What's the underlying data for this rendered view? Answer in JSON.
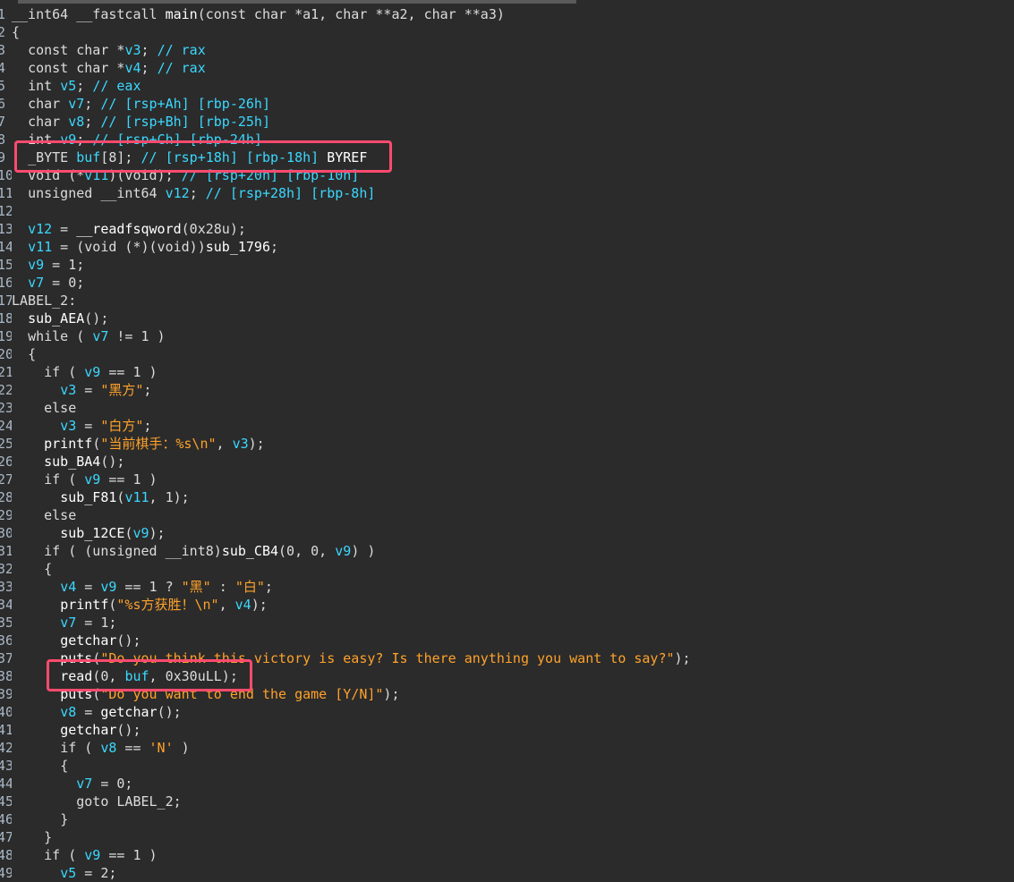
{
  "lines": [
    {
      "n": "1",
      "t": [
        [
          "ty",
          "__int64 __fastcall "
        ],
        [
          "fn",
          "main"
        ],
        [
          "ty",
          "(const char *a1, char **a2, char **a3)"
        ]
      ]
    },
    {
      "n": "2",
      "t": [
        [
          "kw",
          "{"
        ]
      ]
    },
    {
      "n": "3",
      "t": [
        [
          "ind",
          "  "
        ],
        [
          "ty",
          "const char *"
        ],
        [
          "var",
          "v3"
        ],
        [
          "kw",
          "; "
        ],
        [
          "cmt",
          "// rax"
        ]
      ]
    },
    {
      "n": "4",
      "t": [
        [
          "ind",
          "  "
        ],
        [
          "ty",
          "const char *"
        ],
        [
          "var",
          "v4"
        ],
        [
          "kw",
          "; "
        ],
        [
          "cmt",
          "// rax"
        ]
      ]
    },
    {
      "n": "5",
      "t": [
        [
          "ind",
          "  "
        ],
        [
          "ty",
          "int "
        ],
        [
          "var",
          "v5"
        ],
        [
          "kw",
          "; "
        ],
        [
          "cmt",
          "// eax"
        ]
      ]
    },
    {
      "n": "6",
      "t": [
        [
          "ind",
          "  "
        ],
        [
          "ty",
          "char "
        ],
        [
          "var",
          "v7"
        ],
        [
          "kw",
          "; "
        ],
        [
          "cmt",
          "// [rsp+Ah] [rbp-26h]"
        ]
      ]
    },
    {
      "n": "7",
      "t": [
        [
          "ind",
          "  "
        ],
        [
          "ty",
          "char "
        ],
        [
          "var",
          "v8"
        ],
        [
          "kw",
          "; "
        ],
        [
          "cmt",
          "// [rsp+Bh] [rbp-25h]"
        ]
      ]
    },
    {
      "n": "8",
      "t": [
        [
          "ind",
          "  "
        ],
        [
          "ty",
          "int "
        ],
        [
          "var",
          "v9"
        ],
        [
          "kw",
          "; "
        ],
        [
          "cmt",
          "// [rsp+Ch] [rbp-24h]"
        ]
      ]
    },
    {
      "n": "9",
      "t": [
        [
          "ind",
          "  "
        ],
        [
          "ty",
          "_BYTE "
        ],
        [
          "var",
          "buf"
        ],
        [
          "kw",
          "[8]; "
        ],
        [
          "cmt",
          "// [rsp+18h] [rbp-18h] "
        ],
        [
          "byref",
          "BYREF"
        ]
      ]
    },
    {
      "n": "10",
      "t": [
        [
          "ind",
          "  "
        ],
        [
          "ty",
          "void (*"
        ],
        [
          "var",
          "v11"
        ],
        [
          "ty",
          ")(void); "
        ],
        [
          "cmt",
          "// [rsp+20h] [rbp-10h]"
        ]
      ]
    },
    {
      "n": "11",
      "t": [
        [
          "ind",
          "  "
        ],
        [
          "ty",
          "unsigned __int64 "
        ],
        [
          "var",
          "v12"
        ],
        [
          "kw",
          "; "
        ],
        [
          "cmt",
          "// [rsp+28h] [rbp-8h]"
        ]
      ]
    },
    {
      "n": "12",
      "t": []
    },
    {
      "n": "13",
      "t": [
        [
          "ind",
          "  "
        ],
        [
          "var",
          "v12"
        ],
        [
          "kw",
          " = "
        ],
        [
          "fn",
          "__readfsqword"
        ],
        [
          "kw",
          "(0x28u);"
        ]
      ]
    },
    {
      "n": "14",
      "t": [
        [
          "ind",
          "  "
        ],
        [
          "var",
          "v11"
        ],
        [
          "kw",
          " = (void (*)(void))"
        ],
        [
          "fn",
          "sub_1796"
        ],
        [
          "kw",
          ";"
        ]
      ]
    },
    {
      "n": "15",
      "t": [
        [
          "ind",
          "  "
        ],
        [
          "var",
          "v9"
        ],
        [
          "kw",
          " = 1;"
        ]
      ]
    },
    {
      "n": "16",
      "t": [
        [
          "ind",
          "  "
        ],
        [
          "var",
          "v7"
        ],
        [
          "kw",
          " = 0;"
        ]
      ]
    },
    {
      "n": "17",
      "t": [
        [
          "kw",
          "LABEL_2:"
        ]
      ]
    },
    {
      "n": "18",
      "t": [
        [
          "ind",
          "  "
        ],
        [
          "fn",
          "sub_AEA"
        ],
        [
          "kw",
          "();"
        ]
      ]
    },
    {
      "n": "19",
      "t": [
        [
          "ind",
          "  "
        ],
        [
          "kw",
          "while ( "
        ],
        [
          "var",
          "v7"
        ],
        [
          "kw",
          " != 1 )"
        ]
      ]
    },
    {
      "n": "20",
      "t": [
        [
          "ind",
          "  "
        ],
        [
          "kw",
          "{"
        ]
      ]
    },
    {
      "n": "21",
      "t": [
        [
          "ind",
          "    "
        ],
        [
          "kw",
          "if ( "
        ],
        [
          "var",
          "v9"
        ],
        [
          "kw",
          " == 1 )"
        ]
      ]
    },
    {
      "n": "22",
      "t": [
        [
          "ind",
          "      "
        ],
        [
          "var",
          "v3"
        ],
        [
          "kw",
          " = "
        ],
        [
          "str",
          "\"黑方\""
        ],
        [
          "kw",
          ";"
        ]
      ]
    },
    {
      "n": "23",
      "t": [
        [
          "ind",
          "    "
        ],
        [
          "kw",
          "else"
        ]
      ]
    },
    {
      "n": "24",
      "t": [
        [
          "ind",
          "      "
        ],
        [
          "var",
          "v3"
        ],
        [
          "kw",
          " = "
        ],
        [
          "str",
          "\"白方\""
        ],
        [
          "kw",
          ";"
        ]
      ]
    },
    {
      "n": "25",
      "t": [
        [
          "ind",
          "    "
        ],
        [
          "fn",
          "printf"
        ],
        [
          "kw",
          "("
        ],
        [
          "str",
          "\"当前棋手：%s\\n\""
        ],
        [
          "kw",
          ", "
        ],
        [
          "var",
          "v3"
        ],
        [
          "kw",
          ");"
        ]
      ]
    },
    {
      "n": "26",
      "t": [
        [
          "ind",
          "    "
        ],
        [
          "fn",
          "sub_BA4"
        ],
        [
          "kw",
          "();"
        ]
      ]
    },
    {
      "n": "27",
      "t": [
        [
          "ind",
          "    "
        ],
        [
          "kw",
          "if ( "
        ],
        [
          "var",
          "v9"
        ],
        [
          "kw",
          " == 1 )"
        ]
      ]
    },
    {
      "n": "28",
      "t": [
        [
          "ind",
          "      "
        ],
        [
          "fn",
          "sub_F81"
        ],
        [
          "kw",
          "("
        ],
        [
          "var",
          "v11"
        ],
        [
          "kw",
          ", 1);"
        ]
      ]
    },
    {
      "n": "29",
      "t": [
        [
          "ind",
          "    "
        ],
        [
          "kw",
          "else"
        ]
      ]
    },
    {
      "n": "30",
      "t": [
        [
          "ind",
          "      "
        ],
        [
          "fn",
          "sub_12CE"
        ],
        [
          "kw",
          "("
        ],
        [
          "var",
          "v9"
        ],
        [
          "kw",
          ");"
        ]
      ]
    },
    {
      "n": "31",
      "t": [
        [
          "ind",
          "    "
        ],
        [
          "kw",
          "if ( (unsigned __int8)"
        ],
        [
          "fn",
          "sub_CB4"
        ],
        [
          "kw",
          "(0, 0, "
        ],
        [
          "var",
          "v9"
        ],
        [
          "kw",
          ") )"
        ]
      ]
    },
    {
      "n": "32",
      "t": [
        [
          "ind",
          "    "
        ],
        [
          "kw",
          "{"
        ]
      ]
    },
    {
      "n": "33",
      "t": [
        [
          "ind",
          "      "
        ],
        [
          "var",
          "v4"
        ],
        [
          "kw",
          " = "
        ],
        [
          "var",
          "v9"
        ],
        [
          "kw",
          " == 1 ? "
        ],
        [
          "str",
          "\"黑\""
        ],
        [
          "kw",
          " : "
        ],
        [
          "str",
          "\"白\""
        ],
        [
          "kw",
          ";"
        ]
      ]
    },
    {
      "n": "34",
      "t": [
        [
          "ind",
          "      "
        ],
        [
          "fn",
          "printf"
        ],
        [
          "kw",
          "("
        ],
        [
          "str",
          "\"%s方获胜！\\n\""
        ],
        [
          "kw",
          ", "
        ],
        [
          "var",
          "v4"
        ],
        [
          "kw",
          ");"
        ]
      ]
    },
    {
      "n": "35",
      "t": [
        [
          "ind",
          "      "
        ],
        [
          "var",
          "v7"
        ],
        [
          "kw",
          " = 1;"
        ]
      ]
    },
    {
      "n": "36",
      "t": [
        [
          "ind",
          "      "
        ],
        [
          "fn",
          "getchar"
        ],
        [
          "kw",
          "();"
        ]
      ]
    },
    {
      "n": "37",
      "t": [
        [
          "ind",
          "      "
        ],
        [
          "fn",
          "puts"
        ],
        [
          "kw",
          "("
        ],
        [
          "str",
          "\"Do you think this victory is easy? Is there anything you want to say?\""
        ],
        [
          "kw",
          ");"
        ]
      ]
    },
    {
      "n": "38",
      "t": [
        [
          "ind",
          "      "
        ],
        [
          "fn",
          "read"
        ],
        [
          "kw",
          "(0, "
        ],
        [
          "var",
          "buf"
        ],
        [
          "kw",
          ", 0x30uLL);"
        ]
      ]
    },
    {
      "n": "39",
      "t": [
        [
          "ind",
          "      "
        ],
        [
          "fn",
          "puts"
        ],
        [
          "kw",
          "("
        ],
        [
          "str",
          "\"Do you want to end the game [Y/N]\""
        ],
        [
          "kw",
          ");"
        ]
      ]
    },
    {
      "n": "40",
      "t": [
        [
          "ind",
          "      "
        ],
        [
          "var",
          "v8"
        ],
        [
          "kw",
          " = "
        ],
        [
          "fn",
          "getchar"
        ],
        [
          "kw",
          "();"
        ]
      ]
    },
    {
      "n": "41",
      "t": [
        [
          "ind",
          "      "
        ],
        [
          "fn",
          "getchar"
        ],
        [
          "kw",
          "();"
        ]
      ]
    },
    {
      "n": "42",
      "t": [
        [
          "ind",
          "      "
        ],
        [
          "kw",
          "if ( "
        ],
        [
          "var",
          "v8"
        ],
        [
          "kw",
          " == "
        ],
        [
          "chr",
          "'N'"
        ],
        [
          "kw",
          " )"
        ]
      ]
    },
    {
      "n": "43",
      "t": [
        [
          "ind",
          "      "
        ],
        [
          "kw",
          "{"
        ]
      ]
    },
    {
      "n": "44",
      "t": [
        [
          "ind",
          "        "
        ],
        [
          "var",
          "v7"
        ],
        [
          "kw",
          " = 0;"
        ]
      ]
    },
    {
      "n": "45",
      "t": [
        [
          "ind",
          "        "
        ],
        [
          "kw",
          "goto LABEL_2;"
        ]
      ]
    },
    {
      "n": "46",
      "t": [
        [
          "ind",
          "      "
        ],
        [
          "kw",
          "}"
        ]
      ]
    },
    {
      "n": "47",
      "t": [
        [
          "ind",
          "    "
        ],
        [
          "kw",
          "}"
        ]
      ]
    },
    {
      "n": "48",
      "t": [
        [
          "ind",
          "    "
        ],
        [
          "kw",
          "if ( "
        ],
        [
          "var",
          "v9"
        ],
        [
          "kw",
          " == 1 )"
        ]
      ]
    },
    {
      "n": "49",
      "t": [
        [
          "ind",
          "      "
        ],
        [
          "var",
          "v5"
        ],
        [
          "kw",
          " = 2;"
        ]
      ]
    }
  ],
  "highlights": [
    {
      "name": "highlight-buf-declaration",
      "line": 9
    },
    {
      "name": "highlight-read-call",
      "line": 38
    }
  ],
  "colors": {
    "background": "#2b2b2b",
    "variable": "#3ad8ff",
    "string": "#ffa22b",
    "text": "#e6e6e6",
    "highlight": "#ff4b6e"
  }
}
